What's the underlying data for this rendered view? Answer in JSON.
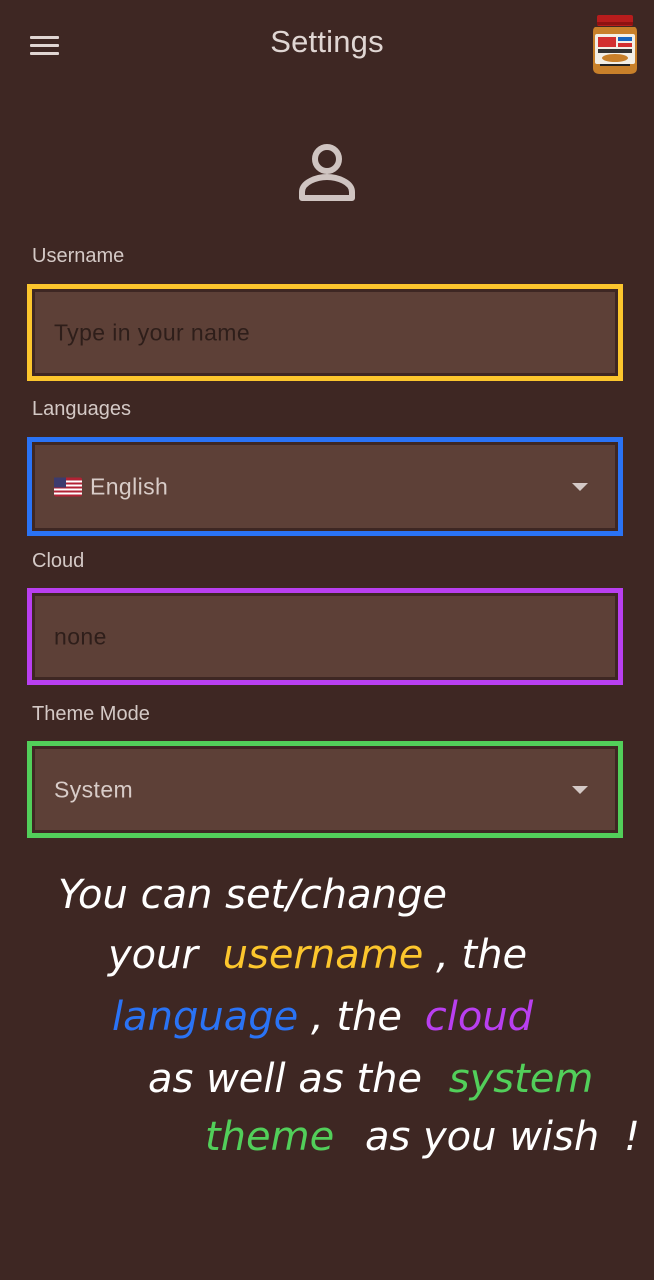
{
  "appbar": {
    "title": "Settings",
    "menu_icon": "hamburger-menu-icon",
    "avatar_icon": "peanut-butter-jar-avatar"
  },
  "profile": {
    "icon": "person-outline-icon"
  },
  "form": {
    "username": {
      "label": "Username",
      "value": "",
      "placeholder": "Type in your name",
      "highlight": "#fcc62d"
    },
    "language": {
      "label": "Languages",
      "flag": "🇺🇸",
      "value": "English",
      "highlight": "#2a73f5"
    },
    "cloud": {
      "label": "Cloud",
      "value": "",
      "placeholder": "none",
      "highlight": "#b93ff0"
    },
    "theme": {
      "label": "Theme Mode",
      "value": "System",
      "highlight": "#52cf5a"
    }
  },
  "annotation": {
    "line1": "You can set/change",
    "line2a": "your",
    "line2b": "username",
    "line2c": ", the",
    "line3a": "language",
    "line3b": ", the",
    "line3c": "cloud",
    "line4a": "as well as the",
    "line4b": "system",
    "line5a": "theme",
    "line5b": "as you wish",
    "line5c": "!"
  },
  "colors": {
    "background": "#3e2723",
    "field_fill": "#5d4037",
    "username": "#fcc62d",
    "language": "#2a73f5",
    "cloud": "#b93ff0",
    "theme": "#52cf5a"
  }
}
